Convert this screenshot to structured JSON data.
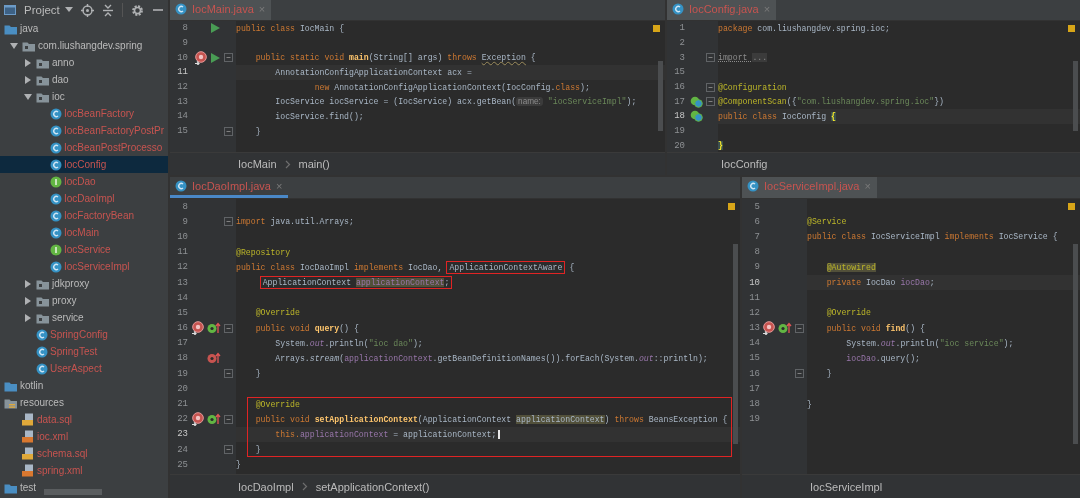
{
  "sidebar": {
    "title": "Project",
    "tree": [
      {
        "label": "java",
        "kind": "source-folder",
        "selected": false,
        "children": [
          {
            "label": "com.liushangdev.spring",
            "kind": "package",
            "expanded": true,
            "selected": false,
            "children": [
              {
                "label": "anno",
                "kind": "package",
                "expanded": false,
                "selected": false
              },
              {
                "label": "dao",
                "kind": "package",
                "expanded": false,
                "selected": false
              },
              {
                "label": "ioc",
                "kind": "package",
                "expanded": true,
                "selected": false,
                "children": [
                  {
                    "label": "IocBeanFactory",
                    "kind": "class",
                    "selected": false
                  },
                  {
                    "label": "IocBeanFactoryPostPr",
                    "kind": "class",
                    "selected": false
                  },
                  {
                    "label": "IocBeanPostProcesso",
                    "kind": "class",
                    "selected": false
                  },
                  {
                    "label": "IocConfig",
                    "kind": "class",
                    "selected": true
                  },
                  {
                    "label": "IocDao",
                    "kind": "interface",
                    "selected": false
                  },
                  {
                    "label": "IocDaoImpl",
                    "kind": "class",
                    "selected": false
                  },
                  {
                    "label": "IocFactoryBean",
                    "kind": "class",
                    "selected": false
                  },
                  {
                    "label": "IocMain",
                    "kind": "class",
                    "selected": false
                  },
                  {
                    "label": "IocService",
                    "kind": "interface",
                    "selected": false
                  },
                  {
                    "label": "IocServiceImpl",
                    "kind": "class",
                    "selected": false
                  }
                ]
              },
              {
                "label": "jdkproxy",
                "kind": "package",
                "expanded": false,
                "selected": false
              },
              {
                "label": "proxy",
                "kind": "package",
                "expanded": false,
                "selected": false
              },
              {
                "label": "service",
                "kind": "package",
                "expanded": false,
                "selected": false
              },
              {
                "label": "SpringConfig",
                "kind": "class",
                "selected": false
              },
              {
                "label": "SpringTest",
                "kind": "class",
                "selected": false
              },
              {
                "label": "UserAspect",
                "kind": "class",
                "selected": false
              }
            ]
          }
        ]
      },
      {
        "label": "kotlin",
        "kind": "source-folder",
        "selected": false
      },
      {
        "label": "resources",
        "kind": "resources-folder",
        "selected": false,
        "children": [
          {
            "label": "data.sql",
            "kind": "sql",
            "selected": false
          },
          {
            "label": "ioc.xml",
            "kind": "xml",
            "selected": false
          },
          {
            "label": "schema.sql",
            "kind": "sql",
            "selected": false
          },
          {
            "label": "spring.xml",
            "kind": "xml",
            "selected": false
          }
        ]
      },
      {
        "label": "test",
        "kind": "folder",
        "selected": false
      }
    ]
  },
  "panes": [
    {
      "tab": {
        "label": "IocMain.java",
        "close": "×",
        "selected": false
      },
      "rows": [
        {
          "kind": "line",
          "num": "8",
          "current": false,
          "marks": [
            {
              "kind": "run"
            }
          ],
          "tokens": [
            {
              "t": "public class ",
              "kind": "kw"
            },
            {
              "t": "IocMain {",
              "kind": "plain"
            }
          ]
        },
        {
          "kind": "line",
          "num": "9",
          "current": false
        },
        {
          "kind": "line",
          "num": "10",
          "current": false,
          "marks": [
            {
              "kind": "target"
            },
            {
              "kind": "run"
            },
            {
              "kind": "fold"
            }
          ],
          "tokens": [
            {
              "t": "    public static void ",
              "kind": "kw"
            },
            {
              "t": "main",
              "kind": "decl"
            },
            {
              "t": "(String[] args) ",
              "kind": "plain"
            },
            {
              "t": "throws ",
              "kind": "kw"
            },
            {
              "t": "Exception",
              "kind": "warn"
            },
            {
              "t": " {",
              "kind": "plain"
            }
          ]
        },
        {
          "kind": "line",
          "num": "11",
          "current": true,
          "tokens": [
            {
              "t": "        AnnotationConfigApplicationContext acx =",
              "kind": "plain"
            }
          ]
        },
        {
          "kind": "line",
          "num": "12",
          "current": false,
          "tokens": [
            {
              "t": "                new ",
              "kind": "kw"
            },
            {
              "t": "AnnotationConfigApplicationContext(IocConfig.",
              "kind": "plain"
            },
            {
              "t": "class",
              "kind": "kw"
            },
            {
              "t": ");",
              "kind": "plain"
            }
          ]
        },
        {
          "kind": "line",
          "num": "13",
          "current": false,
          "tokens": [
            {
              "t": "        IocService iocService = (IocService) acx.getBean(",
              "kind": "plain"
            },
            {
              "t": "name:",
              "kind": "hint"
            },
            {
              "t": "\"iocServiceImpl\"",
              "kind": "str"
            },
            {
              "t": ");",
              "kind": "plain"
            }
          ]
        },
        {
          "kind": "line",
          "num": "14",
          "current": false,
          "tokens": [
            {
              "t": "        iocService.find();",
              "kind": "plain"
            }
          ]
        },
        {
          "kind": "line",
          "num": "15",
          "current": false,
          "marks": [
            {
              "kind": "fold"
            }
          ],
          "tokens": [
            {
              "t": "    }",
              "kind": "plain"
            }
          ]
        }
      ],
      "breadcrumbs": [
        "IocMain",
        "main()"
      ]
    },
    {
      "tab": {
        "label": "IocConfig.java",
        "close": "×",
        "selected": false
      },
      "rows": [
        {
          "kind": "line",
          "num": "1",
          "current": false,
          "tokens": [
            {
              "t": "package ",
              "kind": "kw"
            },
            {
              "t": "com.liushangdev.spring.ioc;",
              "kind": "plain"
            }
          ]
        },
        {
          "kind": "line",
          "num": "2",
          "current": false
        },
        {
          "kind": "line",
          "num": "3",
          "current": false,
          "marks": [
            {
              "kind": "fold"
            }
          ],
          "tokens": [
            {
              "t": "import ",
              "kind": "dim"
            },
            {
              "t": "...",
              "kind": "fold"
            }
          ]
        },
        {
          "kind": "line",
          "num": "15",
          "current": false
        },
        {
          "kind": "line",
          "num": "16",
          "current": false,
          "marks": [
            {
              "kind": "fold"
            }
          ],
          "tokens": [
            {
              "t": "@Configuration",
              "kind": "ann"
            }
          ]
        },
        {
          "kind": "line",
          "num": "17",
          "current": false,
          "marks": [
            {
              "kind": "bean"
            },
            {
              "kind": "fold"
            }
          ],
          "tokens": [
            {
              "t": "@ComponentScan",
              "kind": "ann"
            },
            {
              "t": "({",
              "kind": "plain"
            },
            {
              "t": "\"com.liushangdev.spring.ioc\"",
              "kind": "str"
            },
            {
              "t": "})",
              "kind": "plain"
            }
          ]
        },
        {
          "kind": "line",
          "num": "18",
          "current": true,
          "marks": [
            {
              "kind": "bean"
            }
          ],
          "tokens": [
            {
              "t": "public class ",
              "kind": "kw"
            },
            {
              "t": "IocConfig ",
              "kind": "plain"
            },
            {
              "t": "{",
              "kind": "brace-hl"
            }
          ]
        },
        {
          "kind": "line",
          "num": "19",
          "current": false
        },
        {
          "kind": "line",
          "num": "20",
          "current": false,
          "tokens": [
            {
              "t": "}",
              "kind": "brace-hl"
            }
          ]
        }
      ],
      "breadcrumbs": [
        "IocConfig"
      ]
    },
    {
      "tab": {
        "label": "IocDaoImpl.java",
        "close": "×",
        "selected": true
      },
      "rows": [
        {
          "kind": "line",
          "num": "8",
          "current": false
        },
        {
          "kind": "line",
          "num": "9",
          "current": false,
          "marks": [
            {
              "kind": "fold"
            }
          ],
          "tokens": [
            {
              "t": "import ",
              "kind": "kw"
            },
            {
              "t": "java.util.Arrays;",
              "kind": "plain"
            }
          ]
        },
        {
          "kind": "line",
          "num": "10",
          "current": false
        },
        {
          "kind": "line",
          "num": "11",
          "current": false,
          "tokens": [
            {
              "t": "@Repository",
              "kind": "ann"
            }
          ]
        },
        {
          "kind": "line",
          "num": "12",
          "current": false,
          "tokens": [
            {
              "t": "public class ",
              "kind": "kw"
            },
            {
              "t": "IocDaoImpl ",
              "kind": "plain"
            },
            {
              "t": "implements ",
              "kind": "kw"
            },
            {
              "t": "IocDao,",
              "kind": "plain"
            },
            {
              "kind": "boxed",
              "parts": [
                {
                  "t": "ApplicationContextAware",
                  "kind": "plain"
                }
              ]
            },
            {
              "t": "{",
              "kind": "plain"
            }
          ]
        },
        {
          "kind": "line",
          "num": "13",
          "current": false,
          "tokens": [
            {
              "kind": "boxed",
              "parts": [
                {
                  "t": "    ApplicationContext ",
                  "kind": "plain"
                },
                {
                  "t": "applicationContext",
                  "kind": "field-hl"
                },
                {
                  "t": ";",
                  "kind": "plain"
                }
              ]
            }
          ]
        },
        {
          "kind": "line",
          "num": "14",
          "current": false
        },
        {
          "kind": "line",
          "num": "15",
          "current": false,
          "tokens": [
            {
              "t": "    @Override",
              "kind": "ann"
            }
          ]
        },
        {
          "kind": "line",
          "num": "16",
          "current": false,
          "marks": [
            {
              "kind": "target"
            },
            {
              "kind": "override"
            },
            {
              "kind": "fold"
            }
          ],
          "tokens": [
            {
              "t": "    public void ",
              "kind": "kw"
            },
            {
              "t": "query",
              "kind": "decl"
            },
            {
              "t": "() {",
              "kind": "plain"
            }
          ]
        },
        {
          "kind": "line",
          "num": "17",
          "current": false,
          "tokens": [
            {
              "t": "        System.",
              "kind": "plain"
            },
            {
              "t": "out",
              "kind": "sfield"
            },
            {
              "t": ".println(",
              "kind": "plain"
            },
            {
              "t": "\"ioc dao\"",
              "kind": "str"
            },
            {
              "t": ");",
              "kind": "plain"
            }
          ]
        },
        {
          "kind": "line",
          "num": "18",
          "current": false,
          "marks": [
            {
              "kind": "error-override"
            }
          ],
          "tokens": [
            {
              "t": "        Arrays.",
              "kind": "plain"
            },
            {
              "t": "stream",
              "kind": "italic"
            },
            {
              "t": "(",
              "kind": "plain"
            },
            {
              "t": "applicationContext",
              "kind": "field"
            },
            {
              "t": ".getBeanDefinitionNames()).forEach(System.",
              "kind": "plain"
            },
            {
              "t": "out",
              "kind": "sfield"
            },
            {
              "t": "::println);",
              "kind": "plain"
            }
          ]
        },
        {
          "kind": "line",
          "num": "19",
          "current": false,
          "marks": [
            {
              "kind": "fold"
            }
          ],
          "tokens": [
            {
              "t": "    }",
              "kind": "plain"
            }
          ]
        },
        {
          "kind": "line",
          "num": "20",
          "current": false
        },
        {
          "kind": "box",
          "lines": [
            {
              "kind": "line",
              "num": "21",
              "current": false,
              "tokens": [
                {
                  "t": "    @Override",
                  "kind": "ann"
                }
              ]
            },
            {
              "kind": "line",
              "num": "22",
              "current": false,
              "marks": [
                {
                  "kind": "target"
                },
                {
                  "kind": "override"
                },
                {
                  "kind": "fold"
                }
              ],
              "tokens": [
                {
                  "t": "    public void ",
                  "kind": "kw"
                },
                {
                  "t": "setApplicationContext",
                  "kind": "decl"
                },
                {
                  "t": "(ApplicationContext ",
                  "kind": "plain"
                },
                {
                  "t": "applicationContext",
                  "kind": "plain-hl"
                },
                {
                  "t": ") ",
                  "kind": "plain"
                },
                {
                  "t": "throws ",
                  "kind": "kw"
                },
                {
                  "t": "BeansException {",
                  "kind": "plain"
                }
              ]
            },
            {
              "kind": "line",
              "num": "23",
              "current": true,
              "tokens": [
                {
                  "t": "        this.",
                  "kind": "kw"
                },
                {
                  "t": "applicationContext",
                  "kind": "field"
                },
                {
                  "t": " = applicationContext;",
                  "kind": "plain"
                }
              ]
            },
            {
              "kind": "line",
              "num": "24",
              "current": false,
              "marks": [
                {
                  "kind": "fold"
                }
              ],
              "tokens": [
                {
                  "t": "    }",
                  "kind": "plain"
                }
              ]
            }
          ]
        },
        {
          "kind": "line",
          "num": "25",
          "current": false,
          "tokens": [
            {
              "t": "}",
              "kind": "plain"
            }
          ]
        }
      ],
      "breadcrumbs": [
        "IocDaoImpl",
        "setApplicationContext()"
      ]
    },
    {
      "tab": {
        "label": "IocServiceImpl.java",
        "close": "×",
        "selected": false
      },
      "rows": [
        {
          "kind": "line",
          "num": "5",
          "current": false
        },
        {
          "kind": "line",
          "num": "6",
          "current": false,
          "tokens": [
            {
              "t": "@Service",
              "kind": "ann"
            }
          ]
        },
        {
          "kind": "line",
          "num": "7",
          "current": false,
          "tokens": [
            {
              "t": "public class ",
              "kind": "kw"
            },
            {
              "t": "IocServiceImpl ",
              "kind": "plain"
            },
            {
              "t": "implements ",
              "kind": "kw"
            },
            {
              "t": "IocService {",
              "kind": "plain"
            }
          ]
        },
        {
          "kind": "line",
          "num": "8",
          "current": false
        },
        {
          "kind": "line",
          "num": "9",
          "current": false,
          "tokens": [
            {
              "t": "    @Autowired",
              "kind": "ann-hl"
            }
          ]
        },
        {
          "kind": "line",
          "num": "10",
          "current": true,
          "tokens": [
            {
              "t": "    private ",
              "kind": "kw"
            },
            {
              "t": "IocDao ",
              "kind": "plain"
            },
            {
              "t": "iocDao",
              "kind": "field"
            },
            {
              "t": ";",
              "kind": "plain"
            }
          ]
        },
        {
          "kind": "line",
          "num": "11",
          "current": false
        },
        {
          "kind": "line",
          "num": "12",
          "current": false,
          "tokens": [
            {
              "t": "    @Override",
              "kind": "ann"
            }
          ]
        },
        {
          "kind": "line",
          "num": "13",
          "current": false,
          "marks": [
            {
              "kind": "target"
            },
            {
              "kind": "override"
            },
            {
              "kind": "fold"
            }
          ],
          "tokens": [
            {
              "t": "    public void ",
              "kind": "kw"
            },
            {
              "t": "find",
              "kind": "decl"
            },
            {
              "t": "() {",
              "kind": "plain"
            }
          ]
        },
        {
          "kind": "line",
          "num": "14",
          "current": false,
          "tokens": [
            {
              "t": "        System.",
              "kind": "plain"
            },
            {
              "t": "out",
              "kind": "sfield"
            },
            {
              "t": ".println(",
              "kind": "plain"
            },
            {
              "t": "\"ioc service\"",
              "kind": "str"
            },
            {
              "t": ");",
              "kind": "plain"
            }
          ]
        },
        {
          "kind": "line",
          "num": "15",
          "current": false,
          "tokens": [
            {
              "t": "        iocDao",
              "kind": "field"
            },
            {
              "t": ".query();",
              "kind": "plain"
            }
          ]
        },
        {
          "kind": "line",
          "num": "16",
          "current": false,
          "marks": [
            {
              "kind": "fold"
            }
          ],
          "tokens": [
            {
              "t": "    }",
              "kind": "plain"
            }
          ]
        },
        {
          "kind": "line",
          "num": "17",
          "current": false
        },
        {
          "kind": "line",
          "num": "18",
          "current": false,
          "tokens": [
            {
              "t": "}",
              "kind": "plain"
            }
          ]
        },
        {
          "kind": "line",
          "num": "19",
          "current": false
        }
      ],
      "breadcrumbs": [
        "IocServiceImpl"
      ]
    }
  ]
}
